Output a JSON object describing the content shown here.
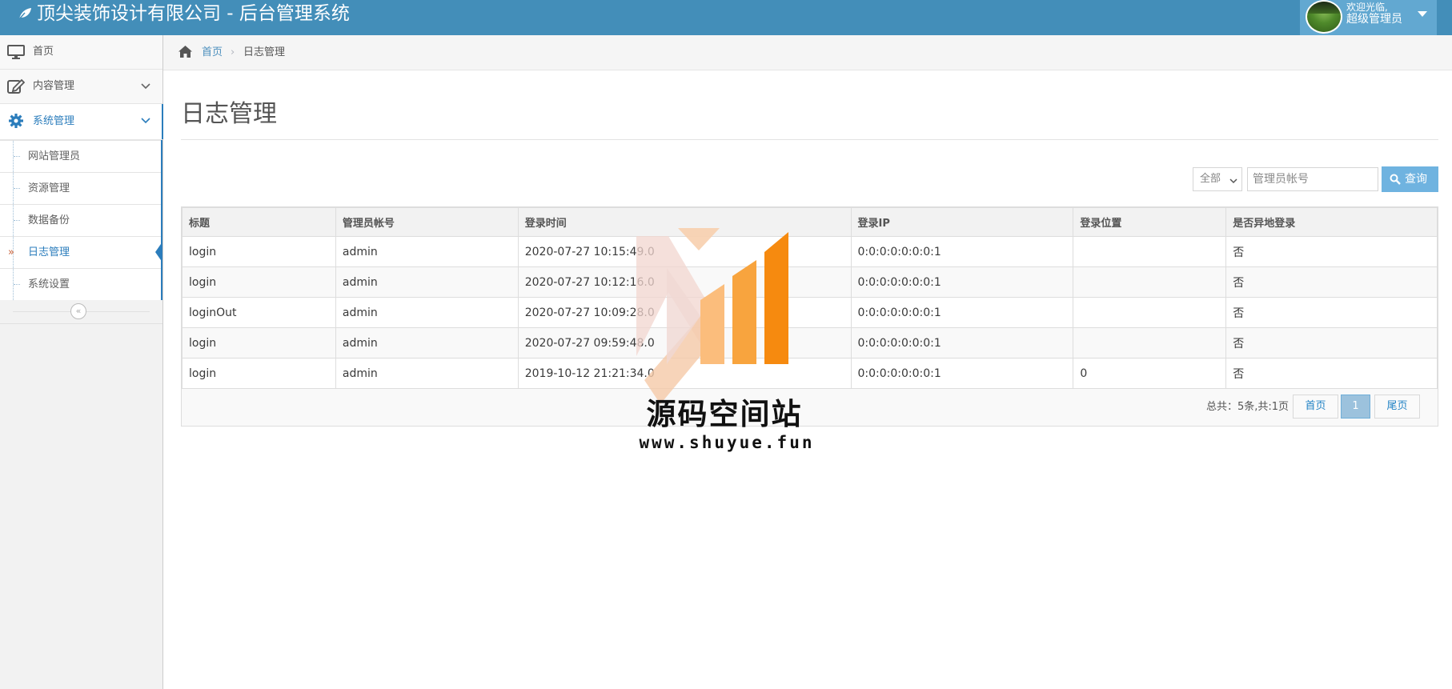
{
  "app": {
    "title": "顶尖装饰设计有限公司 - 后台管理系统",
    "welcome": "欢迎光临,",
    "role": "超级管理员"
  },
  "colors": {
    "navbar": "#438eb9",
    "accent": "#2b7dbc",
    "button": "#6fb3e0"
  },
  "sidebar": {
    "items": [
      {
        "label": "首页",
        "icon": "desktop-icon"
      },
      {
        "label": "内容管理",
        "icon": "edit-icon"
      },
      {
        "label": "系统管理",
        "icon": "gear-icon"
      }
    ],
    "submenu": [
      {
        "label": "网站管理员"
      },
      {
        "label": "资源管理"
      },
      {
        "label": "数据备份"
      },
      {
        "label": "日志管理",
        "active": true
      },
      {
        "label": "系统设置"
      }
    ],
    "collapse": "«"
  },
  "breadcrumb": {
    "home": "首页",
    "current": "日志管理"
  },
  "page": {
    "title": "日志管理"
  },
  "search": {
    "filter_selected": "全部",
    "placeholder": "管理员帐号",
    "button": "查询"
  },
  "table": {
    "headers": [
      "标题",
      "管理员帐号",
      "登录时间",
      "登录IP",
      "登录位置",
      "是否异地登录"
    ],
    "rows": [
      [
        "login",
        "admin",
        "2020-07-27 10:15:49.0",
        "0:0:0:0:0:0:0:1",
        "",
        "否"
      ],
      [
        "login",
        "admin",
        "2020-07-27 10:12:16.0",
        "0:0:0:0:0:0:0:1",
        "",
        "否"
      ],
      [
        "loginOut",
        "admin",
        "2020-07-27 10:09:28.0",
        "0:0:0:0:0:0:0:1",
        "",
        "否"
      ],
      [
        "login",
        "admin",
        "2020-07-27 09:59:48.0",
        "0:0:0:0:0:0:0:1",
        "",
        "否"
      ],
      [
        "login",
        "admin",
        "2019-10-12 21:21:34.0",
        "0:0:0:0:0:0:0:1",
        "0",
        "否"
      ]
    ]
  },
  "pagination": {
    "summary": "总共：5条,共:1页",
    "first": "首页",
    "current": "1",
    "last": "尾页"
  },
  "watermark": {
    "text": "源码空间站",
    "url": "www.shuyue.fun"
  }
}
